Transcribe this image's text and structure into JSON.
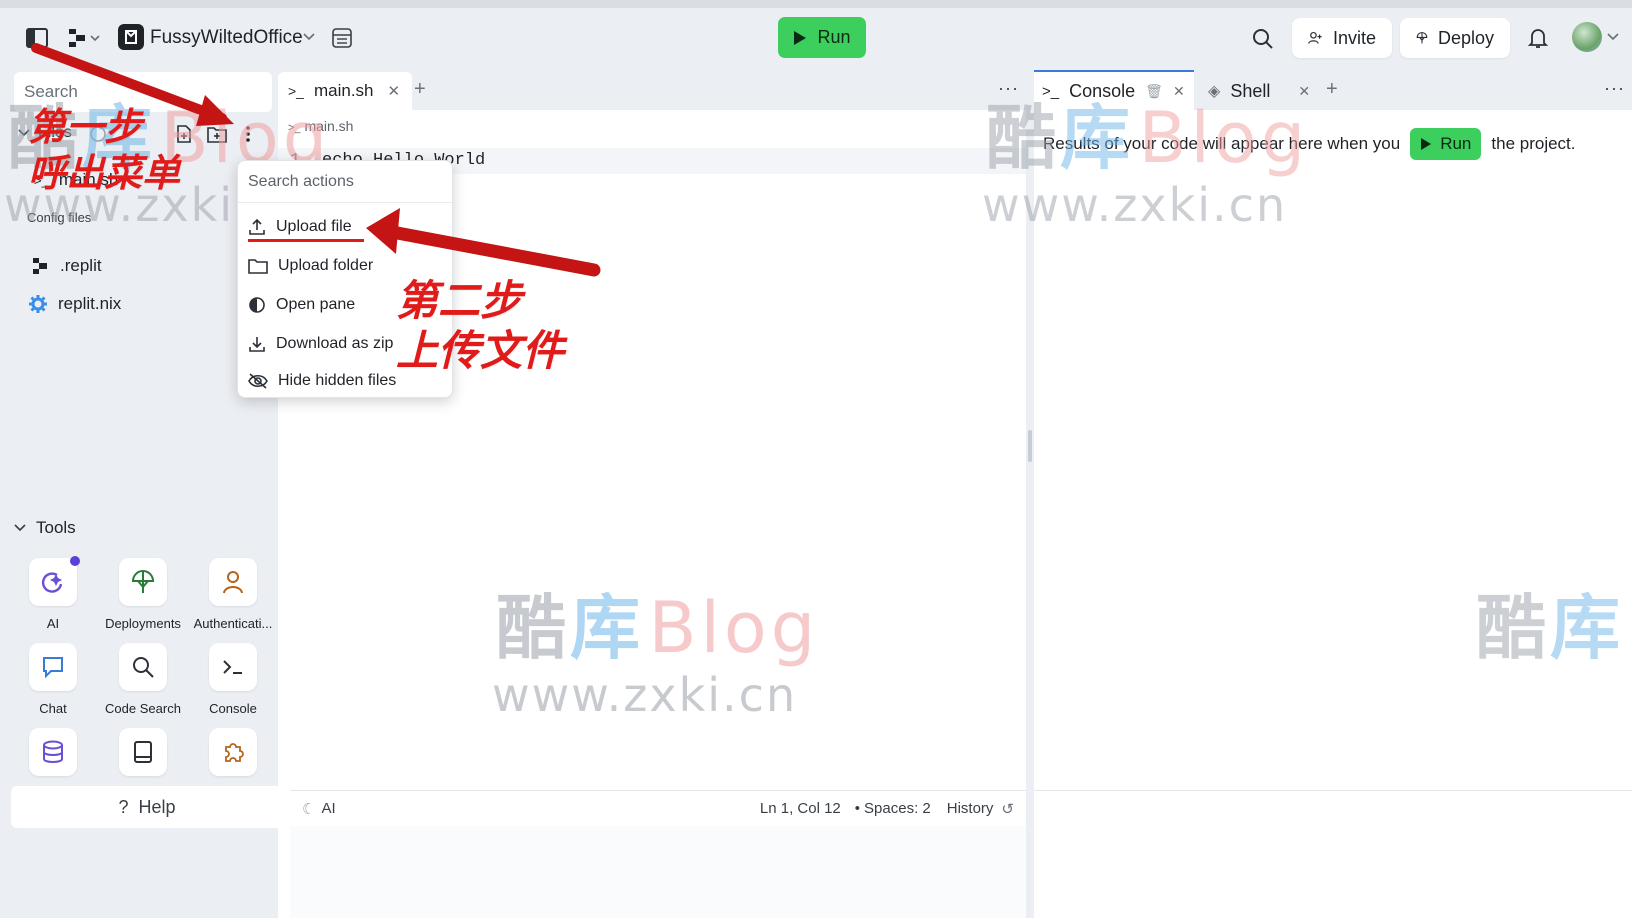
{
  "topbar": {
    "project_name": "FussyWiltedOffice",
    "run_label": "Run",
    "invite_label": "Invite",
    "deploy_label": "Deploy"
  },
  "sidebar": {
    "search_placeholder": "Search",
    "files_header": "Files",
    "files": [
      {
        "label": "main.sh",
        "icon": "terminal-icon"
      },
      {
        "label": ".replit",
        "icon": "replit-logo-icon"
      },
      {
        "label": "replit.nix",
        "icon": "gear-icon"
      }
    ],
    "config_files_label": "Config files",
    "tools_header": "Tools",
    "tools": [
      {
        "label": "AI",
        "icon": "ai-sparkle-icon"
      },
      {
        "label": "Deployments",
        "icon": "deploy-icon"
      },
      {
        "label": "Authenticati...",
        "icon": "user-icon"
      },
      {
        "label": "Chat",
        "icon": "chat-icon"
      },
      {
        "label": "Code Search",
        "icon": "search-icon"
      },
      {
        "label": "Console",
        "icon": "terminal-icon"
      },
      {
        "label": "",
        "icon": "database-icon"
      },
      {
        "label": "",
        "icon": "book-icon"
      },
      {
        "label": "",
        "icon": "puzzle-icon"
      }
    ],
    "help_label": "Help"
  },
  "editor": {
    "tab_label": "main.sh",
    "breadcrumb": "main.sh",
    "line_number": "1",
    "code": "echo Hello World",
    "status": {
      "ai_label": "AI",
      "cursor": "Ln 1, Col 12",
      "spaces": "Spaces: 2",
      "history": "History"
    }
  },
  "context_menu": {
    "search_placeholder": "Search actions",
    "items": [
      {
        "label": "Upload file",
        "icon": "upload-icon"
      },
      {
        "label": "Upload folder",
        "icon": "folder-icon"
      },
      {
        "label": "Open pane",
        "icon": "pane-icon"
      },
      {
        "label": "Download as zip",
        "icon": "download-icon"
      },
      {
        "label": "Hide hidden files",
        "icon": "eye-off-icon"
      }
    ]
  },
  "right_pane": {
    "console_tab": "Console",
    "shell_tab": "Shell",
    "message_prefix": "Results of your code will appear here when you",
    "message_run": "Run",
    "message_suffix": "the project."
  },
  "annotations": {
    "step1_line1": "第一步",
    "step1_line2": "呼出菜单",
    "step2_line1": "第二步",
    "step2_line2": "上传文件"
  },
  "watermark": {
    "cn_1": "酷",
    "cn_2": "库",
    "latin": "Blog",
    "url": "www.zxki.cn"
  },
  "colors": {
    "run_green": "#3ccf5e",
    "annotation_red": "#e11a1a",
    "console_tab_accent": "#3a7bd5"
  }
}
